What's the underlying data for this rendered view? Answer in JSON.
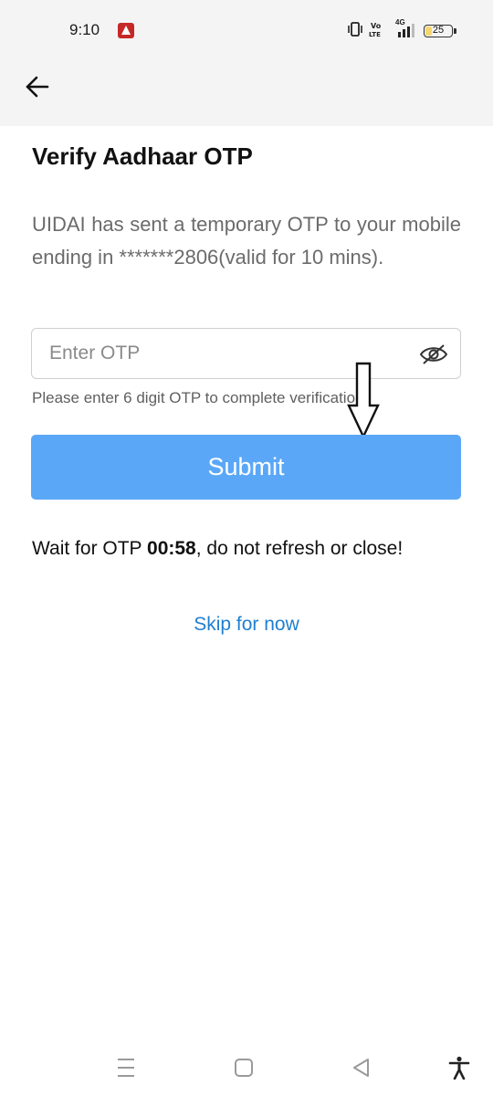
{
  "status_bar": {
    "time": "9:10",
    "network_label": "4G",
    "battery": "25",
    "battery_level": 0.25,
    "icons": [
      "notification-icon",
      "vibrate-icon",
      "volte-icon",
      "signal-icon",
      "battery-icon"
    ]
  },
  "appbar": {
    "back_icon": "arrow-left-icon"
  },
  "main": {
    "title": "Verify Aadhaar OTP",
    "description": "UIDAI has sent a temporary OTP to your mobile ending in *******2806(valid for 10 mins).",
    "otp_input": {
      "placeholder": "Enter OTP",
      "value": "",
      "toggle_icon": "eye-off-icon"
    },
    "helper_text": "Please enter 6 digit OTP to complete verification",
    "submit_label": "Submit",
    "wait": {
      "prefix": "Wait for OTP ",
      "timer": "00:58",
      "suffix": ", do not refresh or close!"
    },
    "skip_label": "Skip for now"
  },
  "nav_bar": {
    "icons": [
      "menu-lines-icon",
      "home-square-icon",
      "back-triangle-icon",
      "accessibility-icon"
    ]
  },
  "colors": {
    "submit_bg": "#5ba7f7",
    "link": "#1f7fd1",
    "status_bg": "#f4f4f4"
  }
}
